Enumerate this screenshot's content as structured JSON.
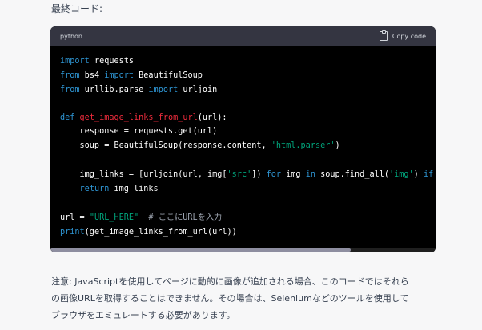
{
  "heading": "最終コード:",
  "code_block": {
    "language": "python",
    "copy_label": "Copy code",
    "lines": [
      [
        {
          "t": "import",
          "c": "kw"
        },
        {
          "t": " requests",
          "c": ""
        }
      ],
      [
        {
          "t": "from",
          "c": "kw"
        },
        {
          "t": " bs4 ",
          "c": ""
        },
        {
          "t": "import",
          "c": "kw"
        },
        {
          "t": " BeautifulSoup",
          "c": ""
        }
      ],
      [
        {
          "t": "from",
          "c": "kw"
        },
        {
          "t": " urllib.parse ",
          "c": ""
        },
        {
          "t": "import",
          "c": "kw"
        },
        {
          "t": " urljoin",
          "c": ""
        }
      ],
      [],
      [
        {
          "t": "def",
          "c": "kw"
        },
        {
          "t": " ",
          "c": ""
        },
        {
          "t": "get_image_links_from_url",
          "c": "fn"
        },
        {
          "t": "(url):",
          "c": ""
        }
      ],
      [
        {
          "t": "    response = requests.get(url)",
          "c": ""
        }
      ],
      [
        {
          "t": "    soup = BeautifulSoup(response.content, ",
          "c": ""
        },
        {
          "t": "'html.parser'",
          "c": "str"
        },
        {
          "t": ")",
          "c": ""
        }
      ],
      [],
      [
        {
          "t": "    img_links = [urljoin(url, img[",
          "c": ""
        },
        {
          "t": "'src'",
          "c": "str"
        },
        {
          "t": "]) ",
          "c": ""
        },
        {
          "t": "for",
          "c": "kw"
        },
        {
          "t": " img ",
          "c": ""
        },
        {
          "t": "in",
          "c": "kw"
        },
        {
          "t": " soup.find_all(",
          "c": ""
        },
        {
          "t": "'img'",
          "c": "str"
        },
        {
          "t": ") ",
          "c": ""
        },
        {
          "t": "if",
          "c": "kw"
        }
      ],
      [
        {
          "t": "    ",
          "c": ""
        },
        {
          "t": "return",
          "c": "kw"
        },
        {
          "t": " img_links",
          "c": ""
        }
      ],
      [],
      [
        {
          "t": "url = ",
          "c": ""
        },
        {
          "t": "\"URL_HERE\"",
          "c": "str"
        },
        {
          "t": "  # ここにURLを入力",
          "c": "cm"
        }
      ],
      [
        {
          "t": "print",
          "c": "kw"
        },
        {
          "t": "(get_image_links_from_url(url))",
          "c": ""
        }
      ]
    ]
  },
  "note": [
    "注意: JavaScriptを使用してページに動的に画像が追加される場合、このコードではそれら",
    "の画像URLを取得することはできません。その場合は、Seleniumなどのツールを使用して",
    "ブラウザをエミュレートする必要があります。"
  ],
  "scroll_fraction": 0.78
}
